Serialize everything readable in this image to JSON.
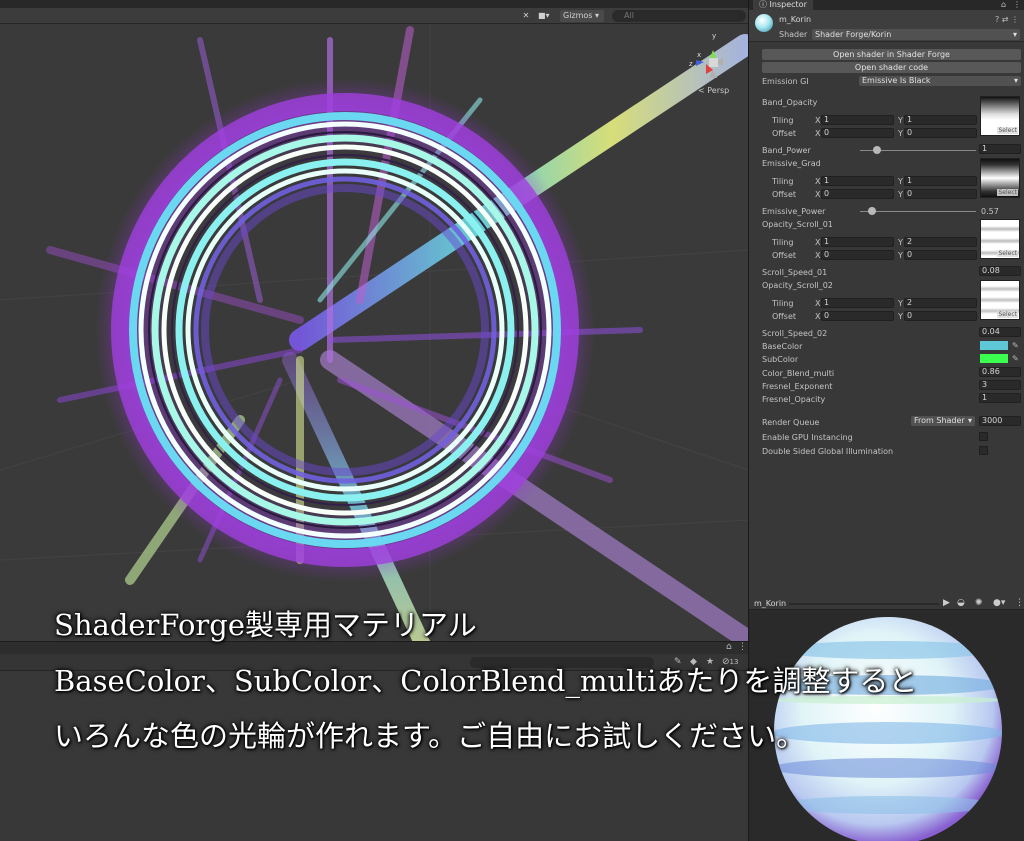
{
  "scene": {
    "toolbar": {
      "gizmos_label": "Gizmos",
      "search_placeholder": "All"
    },
    "axis_gizmo": {
      "x_label": "x",
      "z_label": "z",
      "y_label": "y"
    },
    "persp_label": "< Persp"
  },
  "inspector": {
    "tab_label": "Inspector",
    "material_name": "m_Korin",
    "shader_label": "Shader",
    "shader_value": "Shader Forge/Korin",
    "buttons": {
      "open_shader_forge": "Open shader in Shader Forge",
      "open_shader_code": "Open shader code"
    },
    "emission_gi": {
      "label": "Emission GI",
      "value": "Emissive Is Black"
    },
    "texture_select_label": "Select",
    "tiling_label": "Tiling",
    "offset_label": "Offset",
    "x_label": "X",
    "y_label": "Y",
    "properties": {
      "band_opacity": {
        "label": "Band_Opacity",
        "tiling_x": "1",
        "tiling_y": "1",
        "offset_x": "0",
        "offset_y": "0"
      },
      "band_power": {
        "label": "Band_Power",
        "value": "1",
        "fraction": 0.15
      },
      "emissive_grad": {
        "label": "Emissive_Grad",
        "tiling_x": "1",
        "tiling_y": "1",
        "offset_x": "0",
        "offset_y": "0"
      },
      "emissive_power": {
        "label": "Emissive_Power",
        "value": "0.57",
        "fraction": 0.1
      },
      "opacity_scroll_01": {
        "label": "Opacity_Scroll_01",
        "tiling_x": "1",
        "tiling_y": "2",
        "offset_x": "0",
        "offset_y": "0"
      },
      "scroll_speed_01": {
        "label": "Scroll_Speed_01",
        "value": "0.08"
      },
      "opacity_scroll_02": {
        "label": "Opacity_Scroll_02",
        "tiling_x": "1",
        "tiling_y": "2",
        "offset_x": "0",
        "offset_y": "0"
      },
      "scroll_speed_02": {
        "label": "Scroll_Speed_02",
        "value": "0.04"
      },
      "base_color": {
        "label": "BaseColor",
        "color": "#5ec7d8"
      },
      "sub_color": {
        "label": "SubColor",
        "color": "#3bff4f"
      },
      "color_blend_multi": {
        "label": "Color_Blend_multi",
        "value": "0.86"
      },
      "fresnel_exponent": {
        "label": "Fresnel_Exponent",
        "value": "3"
      },
      "fresnel_opacity": {
        "label": "Fresnel_Opacity",
        "value": "1"
      }
    },
    "render_queue": {
      "label": "Render Queue",
      "mode": "From Shader",
      "value": "3000"
    },
    "gpu_instancing_label": "Enable GPU Instancing",
    "double_sided_gi_label": "Double Sided Global Illumination"
  },
  "preview": {
    "title": "m_Korin"
  },
  "lower_panel": {
    "count_badge": "13"
  },
  "captions": {
    "line1": "ShaderForge製専用マテリアル",
    "line2": "BaseColor、SubColor、ColorBlend_multiあたりを調整すると",
    "line3": "いろんな色の光輪が作れます。ご自由にお試しください。"
  }
}
